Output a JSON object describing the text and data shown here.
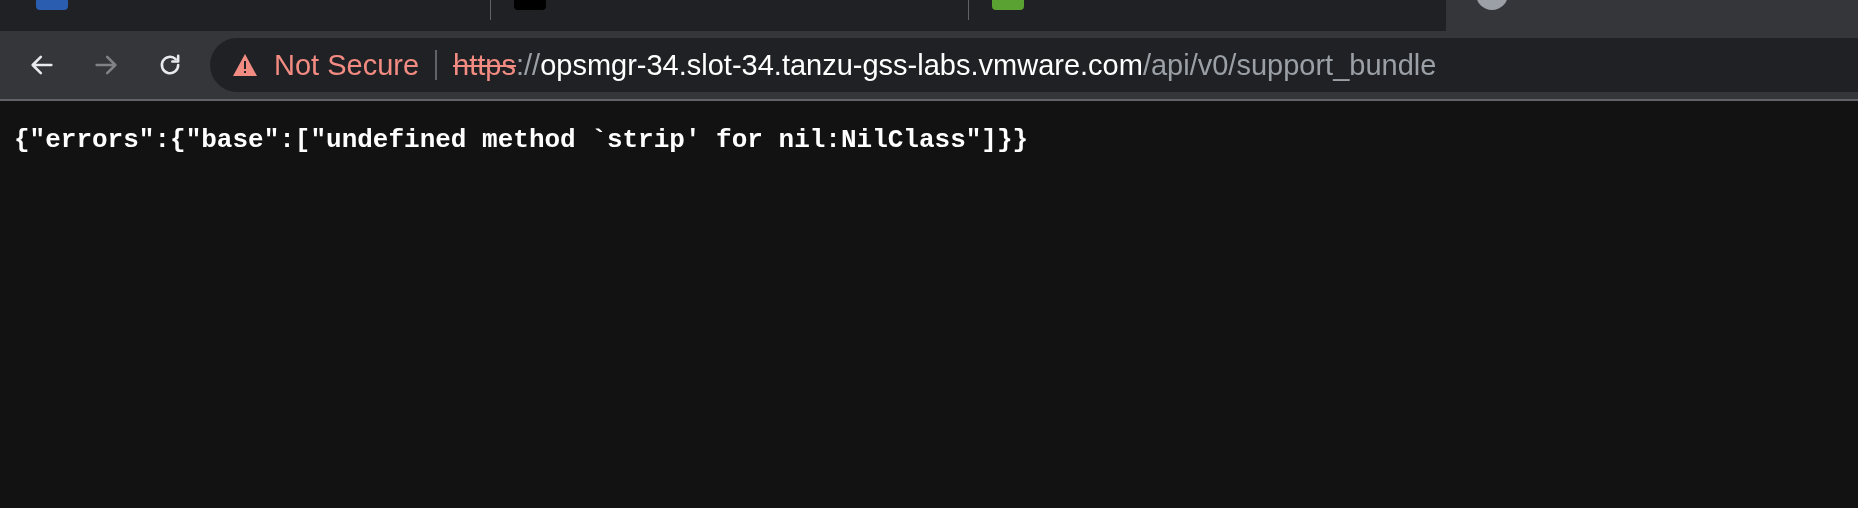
{
  "tabs": [
    {
      "color": "#2a5db0",
      "selected": false
    },
    {
      "color": "#000000",
      "selected": false
    },
    {
      "color": "#5aa332",
      "selected": false
    },
    {
      "color": "#9aa0a6",
      "selected": true
    }
  ],
  "toolbar": {
    "back": {
      "disabled": false
    },
    "forward": {
      "disabled": true
    },
    "address": {
      "security": "Not Secure",
      "scheme": "https",
      "separator": "://",
      "host": "opsmgr-34.slot-34.tanzu-gss-labs.vmware.com",
      "path": "/api/v0/support_bundle"
    }
  },
  "page": {
    "body": "{\"errors\":{\"base\":[\"undefined method `strip' for nil:NilClass\"]}}"
  }
}
